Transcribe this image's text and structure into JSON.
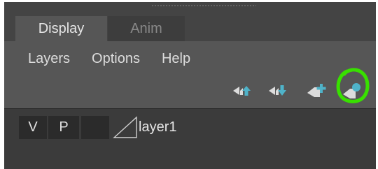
{
  "tabs": [
    {
      "label": "Display",
      "active": true
    },
    {
      "label": "Anim",
      "active": false
    }
  ],
  "menu": [
    {
      "label": "Layers"
    },
    {
      "label": "Options"
    },
    {
      "label": "Help"
    }
  ],
  "toolbar": {
    "icons": [
      "move-selected-layer-up-icon",
      "move-selected-layer-down-icon",
      "create-new-layer-icon",
      "create-layer-from-selected-icon"
    ],
    "icon_color": "#dcdcdc",
    "accent_color": "#4fb3c9",
    "highlight_color": "#38e000"
  },
  "layers": [
    {
      "visibility": "V",
      "playback": "P",
      "color": "",
      "name": "layer1"
    }
  ]
}
